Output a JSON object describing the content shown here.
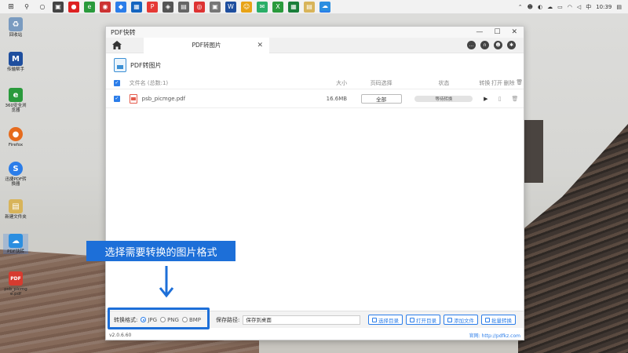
{
  "taskbar": {
    "time": "10:39",
    "lang": "中"
  },
  "desktop_icons": [
    {
      "label": "回收站",
      "color": "#7a9bc0",
      "glyph": "♻"
    },
    {
      "label": "传输帮手",
      "color": "#1e4e9e",
      "glyph": "M"
    },
    {
      "label": "360安全浏览器",
      "color": "#2a9a3c",
      "glyph": "e"
    },
    {
      "label": "Firefox",
      "color": "#e66b1d",
      "glyph": "●"
    },
    {
      "label": "迅捷PDF转换器",
      "color": "#2b7de9",
      "glyph": "S"
    },
    {
      "label": "新建文件夹",
      "color": "#d8b45a",
      "glyph": "▤"
    },
    {
      "label": "PDF快转",
      "color": "#2b8ee0",
      "glyph": "☁"
    },
    {
      "label": "psb_picmge.pdf",
      "color": "#d63b2f",
      "glyph": "PDF"
    }
  ],
  "window": {
    "title": "PDF快转",
    "tab_label": "PDF转图片",
    "section_title": "PDF转图片"
  },
  "table": {
    "headers": {
      "name": "文件名 (总数:1)",
      "size": "大小",
      "range": "页码选择",
      "status": "状态",
      "convert": "转换",
      "open": "打开",
      "delete": "删除"
    },
    "rows": [
      {
        "name": "psb_picmge.pdf",
        "size": "16.6MB",
        "range": "全部",
        "status": "等待转换"
      }
    ]
  },
  "bottom": {
    "format_label": "转换格式:",
    "formats": [
      "JPG",
      "PNG",
      "BMP"
    ],
    "selected_format": "JPG",
    "save_label": "保存路径:",
    "save_value": "保存到桌面",
    "btn_choose_dir": "选择目录",
    "btn_open_dir": "打开目录",
    "btn_add_file": "添加文件",
    "btn_batch": "批量转换"
  },
  "footer": {
    "version": "v2.0.6.60",
    "site": "官网: http://pdfkz.com"
  },
  "annotation": {
    "text": "选择需要转换的图片格式"
  },
  "colors": {
    "accent": "#2b7de9",
    "annotation": "#1d6fd8"
  }
}
